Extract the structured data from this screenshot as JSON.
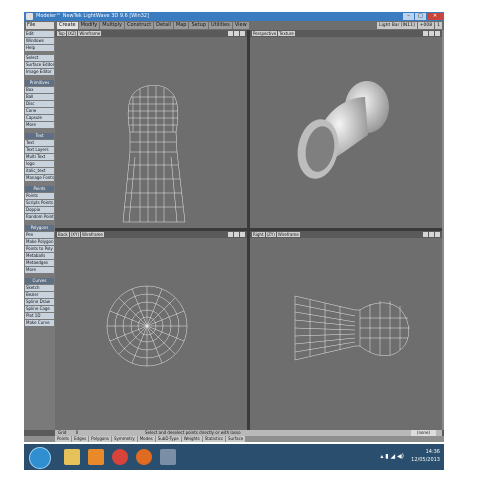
{
  "window": {
    "title": "Modeler™ NewTek LightWave 3D 9.6 [Win32]",
    "controls": [
      "–",
      "□",
      "✕"
    ]
  },
  "menubar": {
    "file_menu": "File",
    "tabs": [
      "Create",
      "Modify",
      "Multiply",
      "Construct",
      "Detail",
      "Map",
      "Setup",
      "Utilities",
      "View"
    ],
    "active_tab": "Create",
    "right": [
      "Light Bar [IN11]",
      "+008",
      "1"
    ]
  },
  "sidebar": {
    "top_items": [
      "Edit",
      "Windows",
      "Help"
    ],
    "groups": [
      {
        "items": [
          "Select",
          "Surface Editor",
          "Image Editor"
        ]
      },
      {
        "head": "Primitives",
        "items": [
          "Box",
          "Ball",
          "Disc",
          "Cone",
          "Capsule",
          "More"
        ]
      },
      {
        "head": "Text",
        "items": [
          "Text",
          "Text Layers",
          "Multi Text",
          "logo",
          "italic_text",
          "Manage Fonts"
        ]
      },
      {
        "head": "Points",
        "items": [
          "Points",
          "Scripts Points",
          "Doppio",
          "Random Points"
        ]
      },
      {
        "head": "Polygons",
        "items": [
          "Pen",
          "Make Polygon",
          "Points to Poly",
          "Metaballs",
          "Metaedges",
          "More"
        ]
      },
      {
        "head": "Curves",
        "items": [
          "Sketch",
          "Bezier",
          "Spline Draw",
          "Spline Cage",
          "Plot 1D",
          "Make Curve"
        ]
      }
    ]
  },
  "viewports": [
    {
      "id": "top",
      "axis": "Top",
      "view": "(XZ)",
      "mode": "Wireframe"
    },
    {
      "id": "perspective",
      "axis": "Perspective",
      "view": "",
      "mode": "Texture"
    },
    {
      "id": "back",
      "axis": "Back",
      "view": "(XY)",
      "mode": "Wireframe"
    },
    {
      "id": "right",
      "axis": "Right",
      "view": "(ZY)",
      "mode": "Wireframe"
    }
  ],
  "status": {
    "grid_label": "Grid",
    "grid_value": "0",
    "hint": "Select and deselect points directly or with lasso",
    "right_value": "(none)"
  },
  "modes": [
    "Points",
    "Edges",
    "Polygons",
    "Symmetry",
    "Modes",
    "SubD-Type",
    "Weights",
    "Statistics",
    "Surface"
  ],
  "taskbar": {
    "time": "14:36",
    "date": "12/05/2013",
    "icons": [
      "explorer",
      "media",
      "chrome",
      "firefox",
      "lightwave"
    ]
  }
}
